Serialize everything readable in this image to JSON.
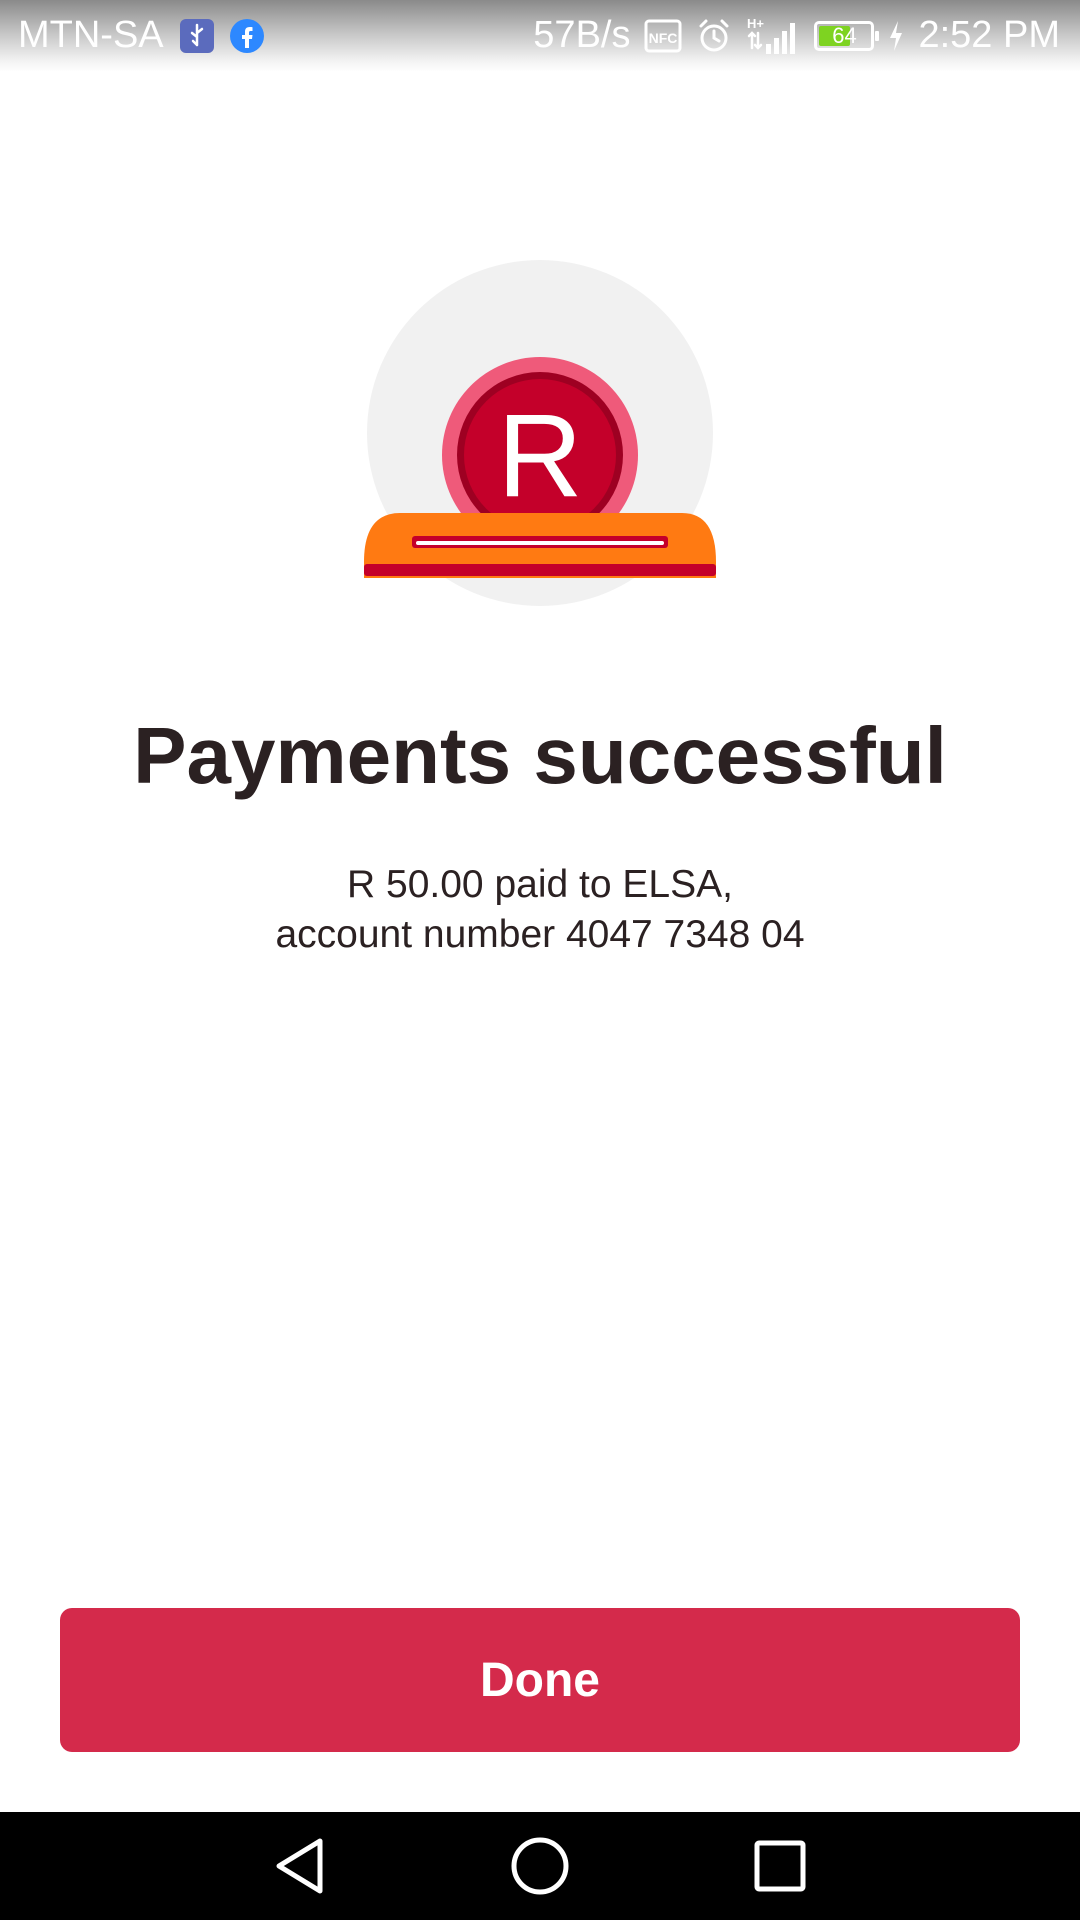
{
  "status_bar": {
    "carrier": "MTN-SA",
    "network_speed": "57B/s",
    "nfc_label": "NFC",
    "network_type": "H+",
    "battery_level": "64",
    "battery_fraction": 0.64,
    "time": "2:52 PM",
    "icons": [
      "usb-icon",
      "facebook-icon",
      "nfc-icon",
      "alarm-icon",
      "signal-icon",
      "battery-icon",
      "charging-icon"
    ]
  },
  "illustration": {
    "coin_symbol": "R",
    "colors": {
      "backdrop": "#f1f1f1",
      "coin_outer": "#ef5a7a",
      "coin_inner": "#c4002a",
      "coin_ring": "#9e0022",
      "slot": "#ff7a12",
      "slot_shadow": "#c4002a"
    }
  },
  "main": {
    "title": "Payments successful",
    "message_line1": "R 50.00 paid to ELSA,",
    "message_line2": "account number 4047 7348 04"
  },
  "actions": {
    "done_label": "Done",
    "accent_color": "#d42a4b"
  },
  "nav_bar": {
    "icons": [
      "back-icon",
      "home-icon",
      "recents-icon"
    ]
  }
}
